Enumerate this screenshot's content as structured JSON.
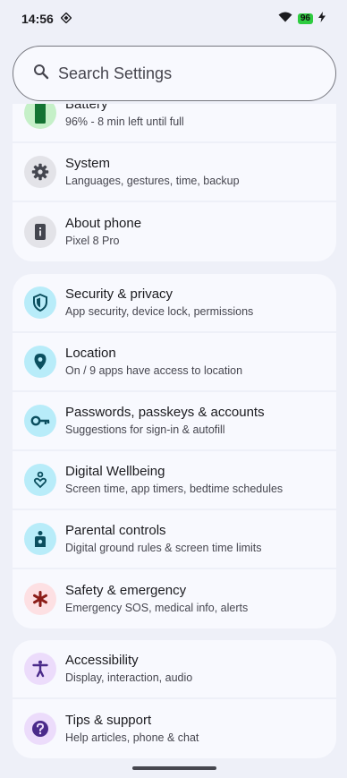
{
  "status": {
    "time": "14:56",
    "battery": "96"
  },
  "search": {
    "placeholder": "Search Settings"
  },
  "group1": [
    {
      "title": "Battery",
      "subtitle": "96% - 8 min left until full",
      "icon": "battery-icon"
    },
    {
      "title": "System",
      "subtitle": "Languages, gestures, time, backup",
      "icon": "gear-icon"
    },
    {
      "title": "About phone",
      "subtitle": "Pixel 8 Pro",
      "icon": "phone-info-icon"
    }
  ],
  "group2": [
    {
      "title": "Security & privacy",
      "subtitle": "App security, device lock, permissions",
      "icon": "shield-icon"
    },
    {
      "title": "Location",
      "subtitle": "On / 9 apps have access to location",
      "icon": "location-pin-icon"
    },
    {
      "title": "Passwords, passkeys & accounts",
      "subtitle": "Suggestions for sign-in & autofill",
      "icon": "key-icon"
    },
    {
      "title": "Digital Wellbeing",
      "subtitle": "Screen time, app timers, bedtime schedules",
      "icon": "wellbeing-icon"
    },
    {
      "title": "Parental controls",
      "subtitle": "Digital ground rules & screen time limits",
      "icon": "parental-icon"
    },
    {
      "title": "Safety & emergency",
      "subtitle": "Emergency SOS, medical info, alerts",
      "icon": "asterisk-icon"
    }
  ],
  "group3": [
    {
      "title": "Accessibility",
      "subtitle": "Display, interaction, audio",
      "icon": "accessibility-icon"
    },
    {
      "title": "Tips & support",
      "subtitle": "Help articles, phone & chat",
      "icon": "help-icon"
    }
  ],
  "colors": {
    "accent_cyan": "#b8ecf9",
    "icon_teal": "#0b4f5f",
    "battery_green": "#2ecc40"
  }
}
